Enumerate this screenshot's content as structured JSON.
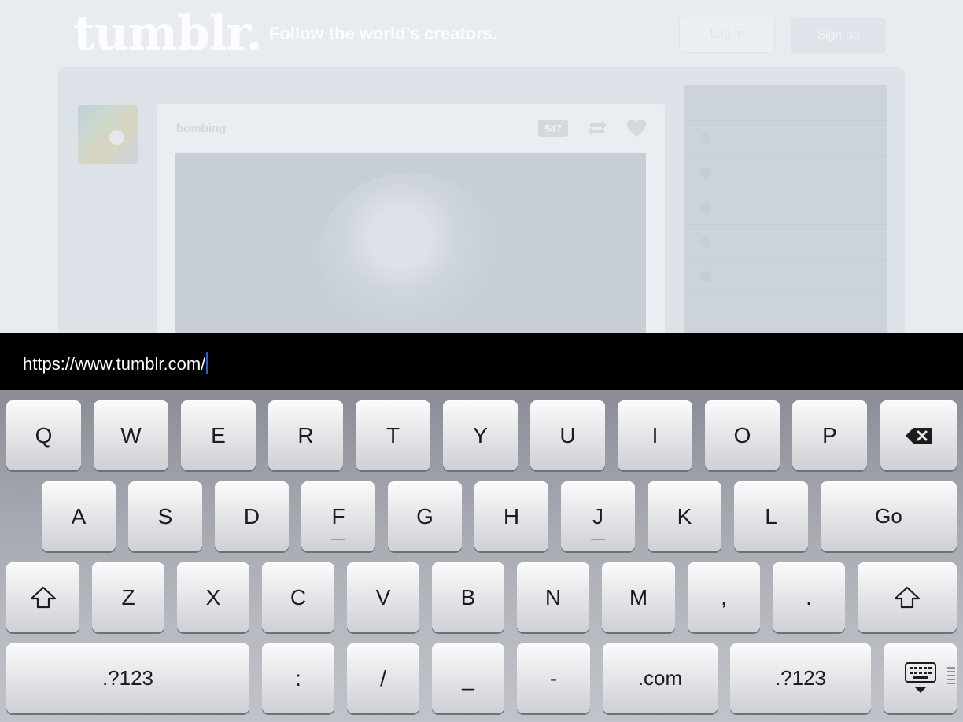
{
  "page": {
    "logo": "tumblr.",
    "tagline": "Follow the world’s creators.",
    "login_label": "Log in",
    "signup_label": "Sign up",
    "post": {
      "blog_name": "bombing",
      "notes_count": "547"
    }
  },
  "url_bar": {
    "value": "https://www.tumblr.com/"
  },
  "keyboard": {
    "row1": [
      "Q",
      "W",
      "E",
      "R",
      "T",
      "Y",
      "U",
      "I",
      "O",
      "P"
    ],
    "row2": [
      "A",
      "S",
      "D",
      "F",
      "G",
      "H",
      "J",
      "K",
      "L"
    ],
    "row3": [
      "Z",
      "X",
      "C",
      "V",
      "B",
      "N",
      "M",
      ",",
      "."
    ],
    "go_label": "Go",
    "numbers_label": ".?123",
    "colon_label": ":",
    "slash_label": "/",
    "underscore_label": "_",
    "dash_label": "-",
    "dotcom_label": ".com",
    "icons": {
      "backspace": "backspace-icon",
      "shift": "shift-icon",
      "dismiss": "keyboard-dismiss-icon"
    }
  },
  "colors": {
    "caret": "#2f5bd8",
    "url_bar_bg": "#000000",
    "key_face": "#e4e5e8"
  }
}
